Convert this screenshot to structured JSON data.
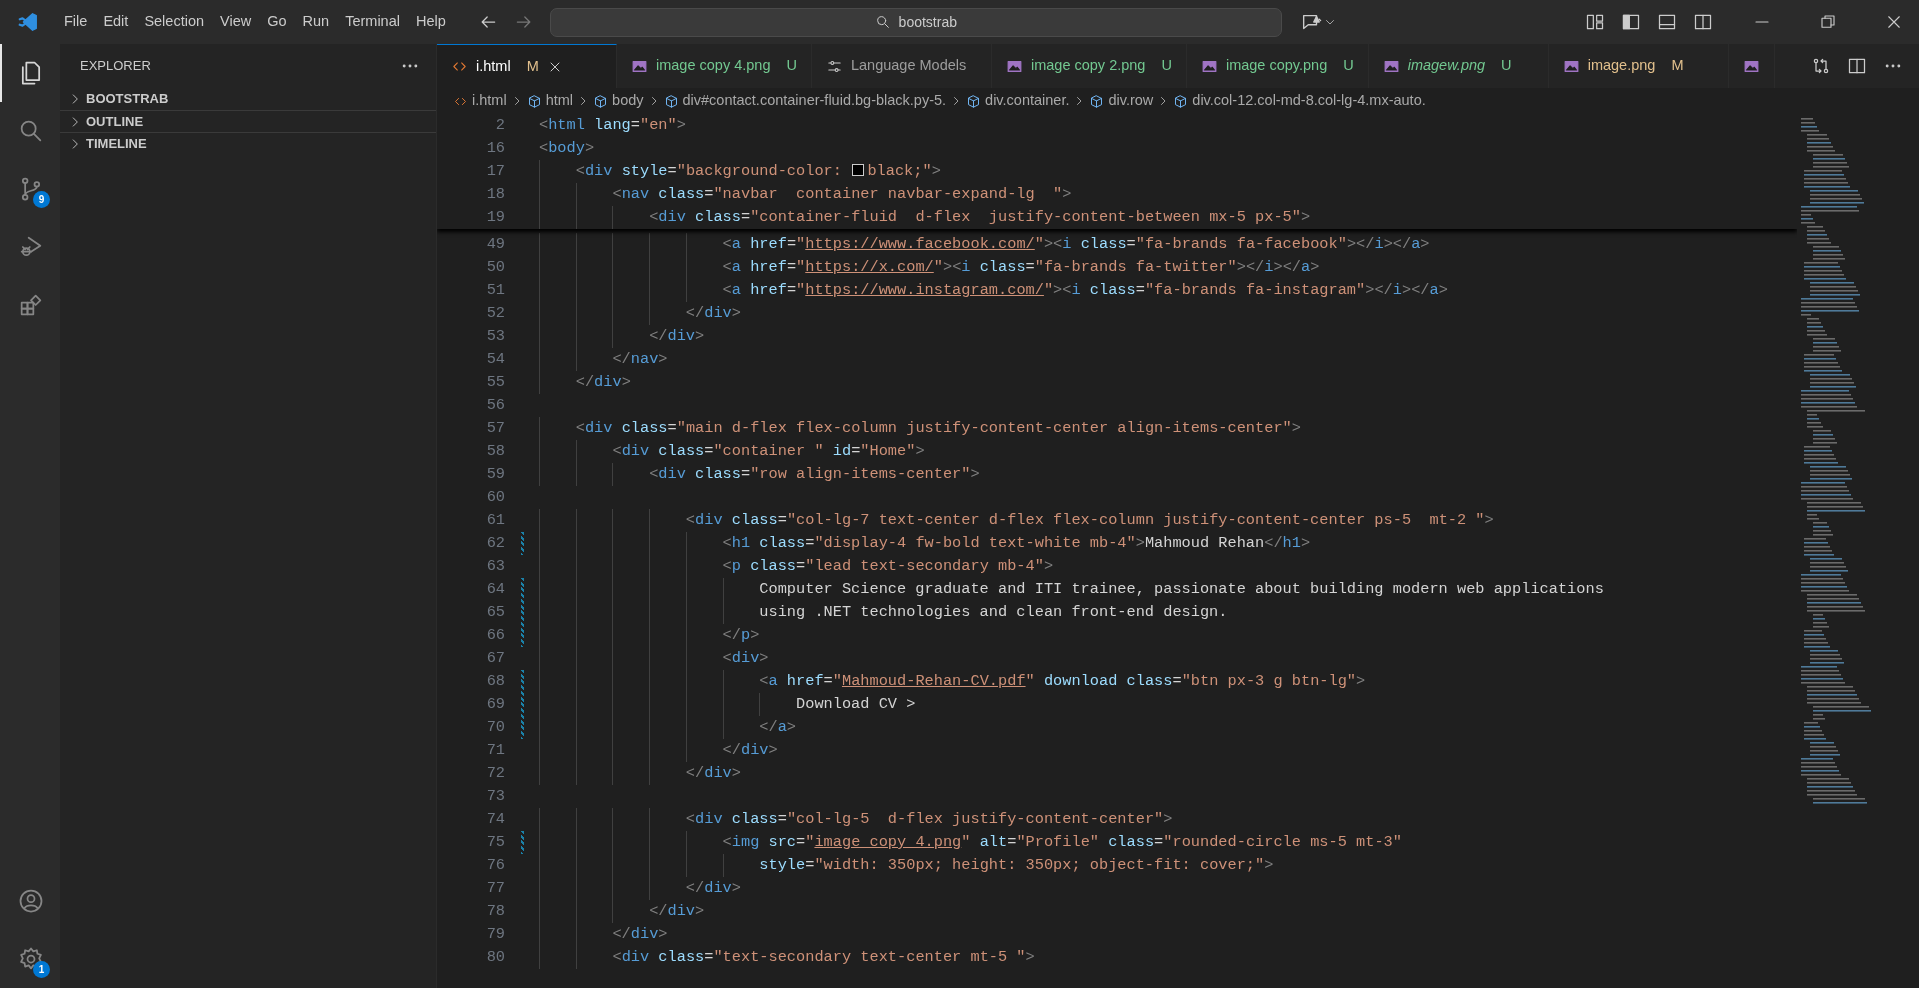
{
  "menu": [
    "File",
    "Edit",
    "Selection",
    "View",
    "Go",
    "Run",
    "Terminal",
    "Help"
  ],
  "search": {
    "value": "bootstrab"
  },
  "activity_bar": [
    {
      "kind": "explorer",
      "selected": true
    },
    {
      "kind": "search",
      "selected": false
    },
    {
      "kind": "source-control",
      "selected": false,
      "badge": "9"
    },
    {
      "kind": "run-debug",
      "selected": false
    },
    {
      "kind": "extensions",
      "selected": false
    }
  ],
  "activity_bar_bottom": [
    {
      "kind": "account"
    },
    {
      "kind": "settings",
      "badge": "1"
    }
  ],
  "sidebar": {
    "title": "EXPLORER",
    "sections": [
      {
        "label": "BOOTSTRAB",
        "expanded": false
      },
      {
        "label": "OUTLINE",
        "expanded": false
      },
      {
        "label": "TIMELINE",
        "expanded": false
      }
    ]
  },
  "tabs": [
    {
      "label": "i.html",
      "kind": "html",
      "badge": "M",
      "color": "#e2c08d",
      "italic": false,
      "selected": true
    },
    {
      "label": "image copy 4.png",
      "kind": "image",
      "badge": "U",
      "color": "#73c991",
      "italic": false,
      "selected": false
    },
    {
      "label": "Language Models",
      "kind": "settings",
      "italic": false,
      "selected": false
    },
    {
      "label": "image copy 2.png",
      "kind": "image",
      "badge": "U",
      "color": "#73c991",
      "italic": false,
      "selected": false
    },
    {
      "label": "image copy.png",
      "kind": "image",
      "badge": "U",
      "color": "#73c991",
      "italic": false,
      "selected": false
    },
    {
      "label": "imagew.png",
      "kind": "image",
      "badge": "U",
      "color": "#73c991",
      "italic": true,
      "selected": false
    },
    {
      "label": "image.png",
      "kind": "image",
      "badge": "M",
      "color": "#e2c08d",
      "italic": false,
      "selected": false
    },
    {
      "kind": "image",
      "selected": false
    }
  ],
  "breadcrumb": [
    {
      "kind": "file",
      "label": "i.html"
    },
    {
      "kind": "element",
      "label": "html"
    },
    {
      "kind": "element",
      "label": "body"
    },
    {
      "kind": "element",
      "label": "div#contact.container-fluid.bg-black.py-5."
    },
    {
      "kind": "element",
      "label": "div.container."
    },
    {
      "kind": "element",
      "label": "div.row"
    },
    {
      "kind": "element",
      "label": "div.col-12.col-md-8.col-lg-4.mx-auto."
    }
  ],
  "sticky_lines": [
    {
      "number": "2",
      "tokens": [
        {
          "kind": "punct",
          "text": "<"
        },
        {
          "kind": "tag",
          "text": "html"
        },
        {
          "kind": "attr",
          "text": " lang"
        },
        {
          "kind": "op",
          "text": "="
        },
        {
          "kind": "str",
          "text": "\"en\""
        },
        {
          "kind": "punct",
          "text": ">"
        }
      ]
    },
    {
      "number": "16",
      "tokens": [
        {
          "kind": "punct",
          "text": "<"
        },
        {
          "kind": "tag",
          "text": "body"
        },
        {
          "kind": "punct",
          "text": ">"
        }
      ]
    },
    {
      "number": "17",
      "tokens": [
        {
          "kind": "punct",
          "text": "    <"
        },
        {
          "kind": "tag",
          "text": "div"
        },
        {
          "kind": "attr",
          "text": " style"
        },
        {
          "kind": "op",
          "text": "="
        },
        {
          "kind": "str",
          "text": "\"background-color: "
        },
        {
          "kind": "swatch",
          "color": "#000000"
        },
        {
          "kind": "str",
          "text": "black;\""
        },
        {
          "kind": "punct",
          "text": ">"
        }
      ]
    },
    {
      "number": "18",
      "tokens": [
        {
          "kind": "punct",
          "text": "        <"
        },
        {
          "kind": "tag",
          "text": "nav"
        },
        {
          "kind": "attr",
          "text": " class"
        },
        {
          "kind": "op",
          "text": "="
        },
        {
          "kind": "str",
          "text": "\"navbar  container navbar-expand-lg  \""
        },
        {
          "kind": "punct",
          "text": ">"
        }
      ]
    },
    {
      "number": "19",
      "tokens": [
        {
          "kind": "punct",
          "text": "            <"
        },
        {
          "kind": "tag",
          "text": "div"
        },
        {
          "kind": "attr",
          "text": " class"
        },
        {
          "kind": "op",
          "text": "="
        },
        {
          "kind": "str",
          "text": "\"container-fluid  d-flex  justify-content-between mx-5 px-5\""
        },
        {
          "kind": "punct",
          "text": ">"
        }
      ]
    }
  ],
  "lines": [
    {
      "number": "49",
      "modified": false,
      "tokens": [
        {
          "kind": "punct",
          "text": "                    <"
        },
        {
          "kind": "tag",
          "text": "a"
        },
        {
          "kind": "attr",
          "text": " href"
        },
        {
          "kind": "op",
          "text": "="
        },
        {
          "kind": "str",
          "text": "\""
        },
        {
          "kind": "link",
          "text": "https://www.facebook.com/"
        },
        {
          "kind": "str",
          "text": "\""
        },
        {
          "kind": "punct",
          "text": "><"
        },
        {
          "kind": "tag",
          "text": "i"
        },
        {
          "kind": "attr",
          "text": " class"
        },
        {
          "kind": "op",
          "text": "="
        },
        {
          "kind": "str",
          "text": "\"fa-brands fa-facebook\""
        },
        {
          "kind": "punct",
          "text": "></"
        },
        {
          "kind": "tag",
          "text": "i"
        },
        {
          "kind": "punct",
          "text": "></"
        },
        {
          "kind": "tag",
          "text": "a"
        },
        {
          "kind": "punct",
          "text": ">"
        }
      ]
    },
    {
      "number": "50",
      "modified": false,
      "tokens": [
        {
          "kind": "punct",
          "text": "                    <"
        },
        {
          "kind": "tag",
          "text": "a"
        },
        {
          "kind": "attr",
          "text": " href"
        },
        {
          "kind": "op",
          "text": "="
        },
        {
          "kind": "str",
          "text": "\""
        },
        {
          "kind": "link",
          "text": "https://x.com/"
        },
        {
          "kind": "str",
          "text": "\""
        },
        {
          "kind": "punct",
          "text": "><"
        },
        {
          "kind": "tag",
          "text": "i"
        },
        {
          "kind": "attr",
          "text": " class"
        },
        {
          "kind": "op",
          "text": "="
        },
        {
          "kind": "str",
          "text": "\"fa-brands fa-twitter\""
        },
        {
          "kind": "punct",
          "text": "></"
        },
        {
          "kind": "tag",
          "text": "i"
        },
        {
          "kind": "punct",
          "text": "></"
        },
        {
          "kind": "tag",
          "text": "a"
        },
        {
          "kind": "punct",
          "text": ">"
        }
      ]
    },
    {
      "number": "51",
      "modified": false,
      "tokens": [
        {
          "kind": "punct",
          "text": "                    <"
        },
        {
          "kind": "tag",
          "text": "a"
        },
        {
          "kind": "attr",
          "text": " href"
        },
        {
          "kind": "op",
          "text": "="
        },
        {
          "kind": "str",
          "text": "\""
        },
        {
          "kind": "link",
          "text": "https://www.instagram.com/"
        },
        {
          "kind": "str",
          "text": "\""
        },
        {
          "kind": "punct",
          "text": "><"
        },
        {
          "kind": "tag",
          "text": "i"
        },
        {
          "kind": "attr",
          "text": " class"
        },
        {
          "kind": "op",
          "text": "="
        },
        {
          "kind": "str",
          "text": "\"fa-brands fa-instagram\""
        },
        {
          "kind": "punct",
          "text": "></"
        },
        {
          "kind": "tag",
          "text": "i"
        },
        {
          "kind": "punct",
          "text": "></"
        },
        {
          "kind": "tag",
          "text": "a"
        },
        {
          "kind": "punct",
          "text": ">"
        }
      ]
    },
    {
      "number": "52",
      "modified": false,
      "tokens": [
        {
          "kind": "punct",
          "text": "                </"
        },
        {
          "kind": "tag",
          "text": "div"
        },
        {
          "kind": "punct",
          "text": ">"
        }
      ]
    },
    {
      "number": "53",
      "modified": false,
      "tokens": [
        {
          "kind": "punct",
          "text": "            </"
        },
        {
          "kind": "tag",
          "text": "div"
        },
        {
          "kind": "punct",
          "text": ">"
        }
      ]
    },
    {
      "number": "54",
      "modified": false,
      "tokens": [
        {
          "kind": "punct",
          "text": "        </"
        },
        {
          "kind": "tag",
          "text": "nav"
        },
        {
          "kind": "punct",
          "text": ">"
        }
      ]
    },
    {
      "number": "55",
      "modified": false,
      "tokens": [
        {
          "kind": "punct",
          "text": "    </"
        },
        {
          "kind": "tag",
          "text": "div"
        },
        {
          "kind": "punct",
          "text": ">"
        }
      ]
    },
    {
      "number": "56",
      "modified": false
    },
    {
      "number": "57",
      "modified": false,
      "tokens": [
        {
          "kind": "punct",
          "text": "    <"
        },
        {
          "kind": "tag",
          "text": "div"
        },
        {
          "kind": "attr",
          "text": " class"
        },
        {
          "kind": "op",
          "text": "="
        },
        {
          "kind": "str",
          "text": "\"main d-flex flex-column justify-content-center align-items-center\""
        },
        {
          "kind": "punct",
          "text": ">"
        }
      ]
    },
    {
      "number": "58",
      "modified": false,
      "tokens": [
        {
          "kind": "punct",
          "text": "        <"
        },
        {
          "kind": "tag",
          "text": "div"
        },
        {
          "kind": "attr",
          "text": " class"
        },
        {
          "kind": "op",
          "text": "="
        },
        {
          "kind": "str",
          "text": "\"container \""
        },
        {
          "kind": "attr",
          "text": " id"
        },
        {
          "kind": "op",
          "text": "="
        },
        {
          "kind": "str",
          "text": "\"Home\""
        },
        {
          "kind": "punct",
          "text": ">"
        }
      ]
    },
    {
      "number": "59",
      "modified": false,
      "tokens": [
        {
          "kind": "punct",
          "text": "            <"
        },
        {
          "kind": "tag",
          "text": "div"
        },
        {
          "kind": "attr",
          "text": " class"
        },
        {
          "kind": "op",
          "text": "="
        },
        {
          "kind": "str",
          "text": "\"row align-items-center\""
        },
        {
          "kind": "punct",
          "text": ">"
        }
      ]
    },
    {
      "number": "60",
      "modified": false
    },
    {
      "number": "61",
      "modified": false,
      "tokens": [
        {
          "kind": "punct",
          "text": "                <"
        },
        {
          "kind": "tag",
          "text": "div"
        },
        {
          "kind": "attr",
          "text": " class"
        },
        {
          "kind": "op",
          "text": "="
        },
        {
          "kind": "str",
          "text": "\"col-lg-7 text-center d-flex flex-column justify-content-center ps-5  mt-2 \""
        },
        {
          "kind": "punct",
          "text": ">"
        }
      ]
    },
    {
      "number": "62",
      "modified": true,
      "tokens": [
        {
          "kind": "punct",
          "text": "                    <"
        },
        {
          "kind": "tag",
          "text": "h1"
        },
        {
          "kind": "attr",
          "text": " class"
        },
        {
          "kind": "op",
          "text": "="
        },
        {
          "kind": "str",
          "text": "\"display-4 fw-bold text-white mb-4\""
        },
        {
          "kind": "punct",
          "text": ">"
        },
        {
          "kind": "text",
          "text": "Mahmoud Rehan"
        },
        {
          "kind": "punct",
          "text": "</"
        },
        {
          "kind": "tag",
          "text": "h1"
        },
        {
          "kind": "punct",
          "text": ">"
        }
      ]
    },
    {
      "number": "63",
      "modified": false,
      "tokens": [
        {
          "kind": "punct",
          "text": "                    <"
        },
        {
          "kind": "tag",
          "text": "p"
        },
        {
          "kind": "attr",
          "text": " class"
        },
        {
          "kind": "op",
          "text": "="
        },
        {
          "kind": "str",
          "text": "\"lead text-secondary mb-4\""
        },
        {
          "kind": "punct",
          "text": ">"
        }
      ]
    },
    {
      "number": "64",
      "modified": true,
      "tokens": [
        {
          "kind": "text",
          "text": "                        Computer Science graduate and ITI trainee, passionate about building modern web applications"
        }
      ]
    },
    {
      "number": "65",
      "modified": true,
      "tokens": [
        {
          "kind": "text",
          "text": "                        using .NET technologies and clean front-end design."
        }
      ]
    },
    {
      "number": "66",
      "modified": true,
      "tokens": [
        {
          "kind": "punct",
          "text": "                    </"
        },
        {
          "kind": "tag",
          "text": "p"
        },
        {
          "kind": "punct",
          "text": ">"
        }
      ]
    },
    {
      "number": "67",
      "modified": false,
      "tokens": [
        {
          "kind": "punct",
          "text": "                    <"
        },
        {
          "kind": "tag",
          "text": "div"
        },
        {
          "kind": "punct",
          "text": ">"
        }
      ]
    },
    {
      "number": "68",
      "modified": true,
      "tokens": [
        {
          "kind": "punct",
          "text": "                        <"
        },
        {
          "kind": "tag",
          "text": "a"
        },
        {
          "kind": "attr",
          "text": " href"
        },
        {
          "kind": "op",
          "text": "="
        },
        {
          "kind": "str",
          "text": "\""
        },
        {
          "kind": "link",
          "text": "Mahmoud-Rehan-CV.pdf"
        },
        {
          "kind": "str",
          "text": "\""
        },
        {
          "kind": "attr",
          "text": " download class"
        },
        {
          "kind": "op",
          "text": "="
        },
        {
          "kind": "str",
          "text": "\"btn px-3 g btn-lg\""
        },
        {
          "kind": "punct",
          "text": ">"
        }
      ]
    },
    {
      "number": "69",
      "modified": true,
      "tokens": [
        {
          "kind": "text",
          "text": "                            Download CV >"
        }
      ]
    },
    {
      "number": "70",
      "modified": true,
      "tokens": [
        {
          "kind": "punct",
          "text": "                        </"
        },
        {
          "kind": "tag",
          "text": "a"
        },
        {
          "kind": "punct",
          "text": ">"
        }
      ]
    },
    {
      "number": "71",
      "modified": false,
      "tokens": [
        {
          "kind": "punct",
          "text": "                    </"
        },
        {
          "kind": "tag",
          "text": "div"
        },
        {
          "kind": "punct",
          "text": ">"
        }
      ]
    },
    {
      "number": "72",
      "modified": false,
      "tokens": [
        {
          "kind": "punct",
          "text": "                </"
        },
        {
          "kind": "tag",
          "text": "div"
        },
        {
          "kind": "punct",
          "text": ">"
        }
      ]
    },
    {
      "number": "73",
      "modified": false
    },
    {
      "number": "74",
      "modified": false,
      "tokens": [
        {
          "kind": "punct",
          "text": "                <"
        },
        {
          "kind": "tag",
          "text": "div"
        },
        {
          "kind": "attr",
          "text": " class"
        },
        {
          "kind": "op",
          "text": "="
        },
        {
          "kind": "str",
          "text": "\"col-lg-5  d-flex justify-content-center\""
        },
        {
          "kind": "punct",
          "text": ">"
        }
      ]
    },
    {
      "number": "75",
      "modified": true,
      "tokens": [
        {
          "kind": "punct",
          "text": "                    <"
        },
        {
          "kind": "tag",
          "text": "img"
        },
        {
          "kind": "attr",
          "text": " src"
        },
        {
          "kind": "op",
          "text": "="
        },
        {
          "kind": "str",
          "text": "\""
        },
        {
          "kind": "link",
          "text": "image copy 4.png"
        },
        {
          "kind": "str",
          "text": "\""
        },
        {
          "kind": "attr",
          "text": " alt"
        },
        {
          "kind": "op",
          "text": "="
        },
        {
          "kind": "str",
          "text": "\"Profile\""
        },
        {
          "kind": "attr",
          "text": " class"
        },
        {
          "kind": "op",
          "text": "="
        },
        {
          "kind": "str",
          "text": "\"rounded-circle ms-5 mt-3\""
        }
      ]
    },
    {
      "number": "76",
      "modified": false,
      "tokens": [
        {
          "kind": "attr",
          "text": "                        style"
        },
        {
          "kind": "op",
          "text": "="
        },
        {
          "kind": "str",
          "text": "\"width: 350px; height: 350px; object-fit: cover;\""
        },
        {
          "kind": "punct",
          "text": ">"
        }
      ]
    },
    {
      "number": "77",
      "modified": false,
      "tokens": [
        {
          "kind": "punct",
          "text": "                </"
        },
        {
          "kind": "tag",
          "text": "div"
        },
        {
          "kind": "punct",
          "text": ">"
        }
      ]
    },
    {
      "number": "78",
      "modified": false,
      "tokens": [
        {
          "kind": "punct",
          "text": "            </"
        },
        {
          "kind": "tag",
          "text": "div"
        },
        {
          "kind": "punct",
          "text": ">"
        }
      ]
    },
    {
      "number": "79",
      "modified": false,
      "tokens": [
        {
          "kind": "punct",
          "text": "        </"
        },
        {
          "kind": "tag",
          "text": "div"
        },
        {
          "kind": "punct",
          "text": ">"
        }
      ]
    },
    {
      "number": "80",
      "modified": false,
      "tokens": [
        {
          "kind": "punct",
          "text": "        <"
        },
        {
          "kind": "tag",
          "text": "div"
        },
        {
          "kind": "attr",
          "text": " class"
        },
        {
          "kind": "op",
          "text": "="
        },
        {
          "kind": "str",
          "text": "\"text-secondary text-center mt-5 \""
        },
        {
          "kind": "punct",
          "text": ">"
        }
      ]
    }
  ]
}
